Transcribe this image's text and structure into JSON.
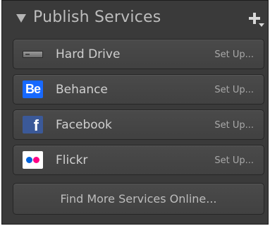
{
  "panel": {
    "title": "Publish Services",
    "add_button_icon": "plus-with-dropdown-icon"
  },
  "services": [
    {
      "name": "Hard Drive",
      "action": "Set Up...",
      "icon": "hard-drive-icon"
    },
    {
      "name": "Behance",
      "action": "Set Up...",
      "icon": "behance-icon",
      "icon_text": "Be",
      "icon_color": "#1769ff"
    },
    {
      "name": "Facebook",
      "action": "Set Up...",
      "icon": "facebook-icon",
      "icon_text": "f",
      "icon_color": "#3b5998"
    },
    {
      "name": "Flickr",
      "action": "Set Up...",
      "icon": "flickr-icon",
      "icon_colors": [
        "#0063dc",
        "#ff0084"
      ]
    }
  ],
  "find_more": {
    "label": "Find More Services Online..."
  },
  "colors": {
    "panel_bg": "#3a3a3a",
    "row_bg": "#454545",
    "text": "#cfcfcf",
    "muted_text": "#a8a8a8"
  }
}
